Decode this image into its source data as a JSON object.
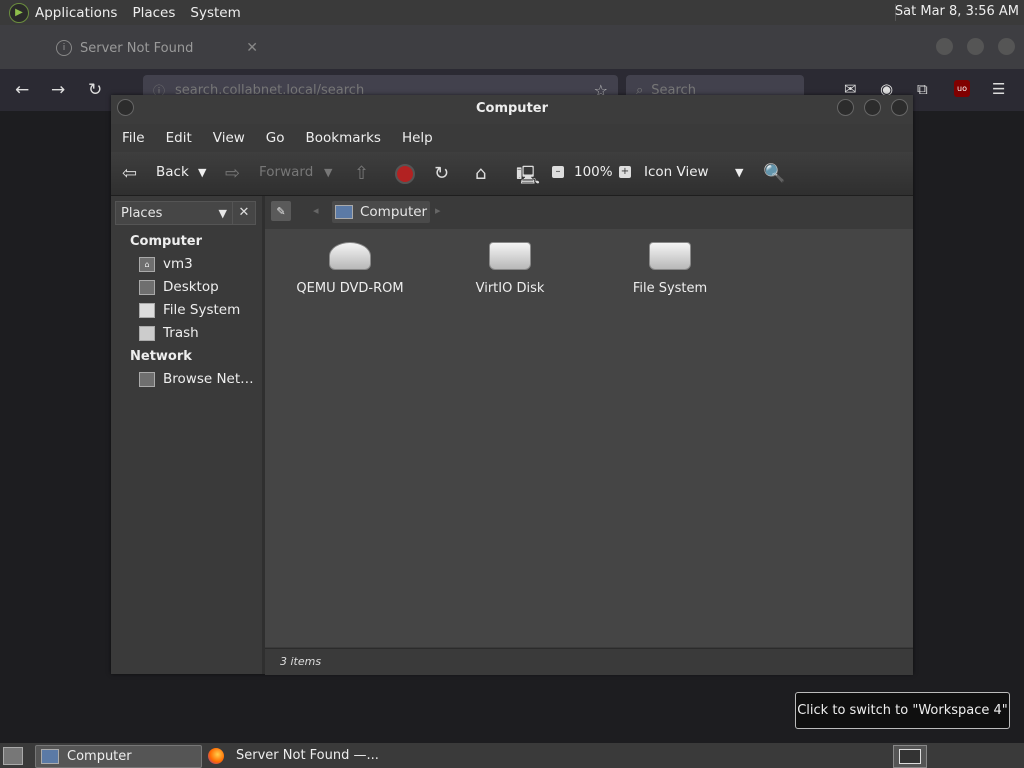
{
  "top_panel": {
    "menus": [
      "Applications",
      "Places",
      "System"
    ],
    "clock": "Sat Mar  8,  3:56 AM"
  },
  "browser": {
    "tab_title": "Server Not Found",
    "url": "search.collabnet.local/search",
    "search_placeholder": "Search",
    "ublock_label": "uo"
  },
  "window": {
    "title": "Computer",
    "menu": [
      "File",
      "Edit",
      "View",
      "Go",
      "Bookmarks",
      "Help"
    ],
    "toolbar": {
      "back": "Back",
      "forward": "Forward",
      "zoom": "100%",
      "view_mode": "Icon View"
    },
    "sidebar": {
      "selector": "Places",
      "sections": [
        {
          "header": "Computer",
          "items": [
            "vm3",
            "Desktop",
            "File System",
            "Trash"
          ]
        },
        {
          "header": "Network",
          "items": [
            "Browse Net…"
          ]
        }
      ]
    },
    "location": {
      "crumb": "Computer"
    },
    "items": [
      "QEMU DVD-ROM",
      "VirtIO Disk",
      "File System"
    ],
    "status": "3 items"
  },
  "tooltip": "Click to switch to \"Workspace 4\"",
  "taskbar": {
    "tasks": [
      "Computer",
      "Server Not Found —..."
    ]
  },
  "icons": {
    "back": "arrow-left-icon",
    "forward": "arrow-right-icon",
    "up": "arrow-up-icon",
    "stop": "stop-icon",
    "reload": "reload-icon",
    "home": "home-folder-icon",
    "computer": "computer-icon",
    "search": "magnifier-icon"
  },
  "colors": {
    "stop": "#b22222",
    "panel": "#3a3a3a",
    "content": "#454545"
  }
}
